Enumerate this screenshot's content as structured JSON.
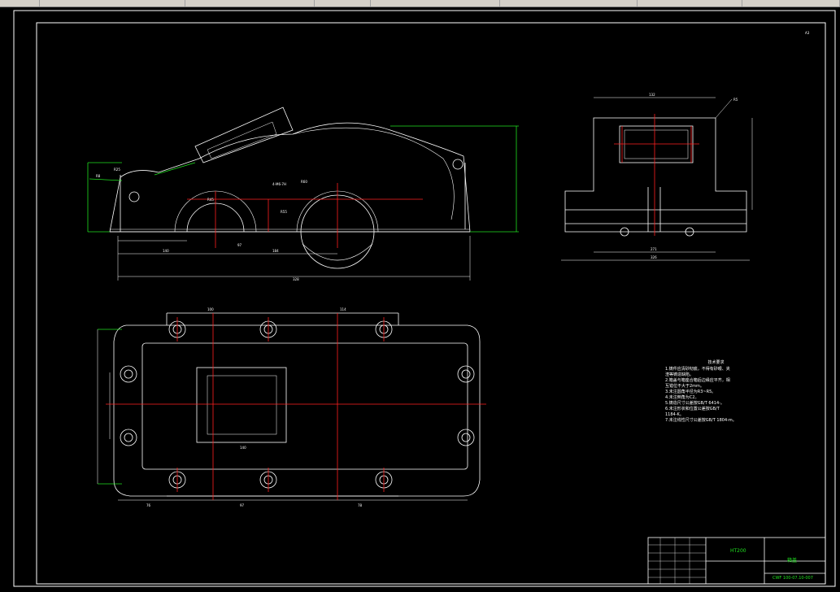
{
  "toolbar": {
    "items": [
      "",
      "",
      "",
      "",
      "",
      "",
      "",
      ""
    ]
  },
  "drawing": {
    "corner_label": "A3",
    "front_view_dims": {
      "d1": "R8",
      "d2": "R25",
      "d3": "R34",
      "d4": "R60",
      "d5": "4-M6-7H",
      "d6": "140",
      "d7": "61",
      "d8": "42",
      "d9": "184",
      "d10": "328",
      "d11": "97",
      "d12": "R55",
      "d13": "R45",
      "d14": "R37",
      "d15": "R40"
    },
    "side_view_dims": {
      "s1": "132",
      "s2": "R5",
      "s3": "271",
      "s4": "326",
      "s5": "6",
      "s6": "10"
    },
    "plan_view_dims": {
      "p1": "100",
      "p2": "114",
      "p3": "140",
      "p4": "100",
      "p5": "97",
      "p6": "78",
      "p7": "76",
      "p8": "78",
      "p9": "140"
    }
  },
  "notes": {
    "title": "技术要求",
    "lines": [
      "1.铸件应清砂彻底，不得有砂眼、夹",
      "渣等铸造缺陷。",
      "2.箱盖与箱座合箱后边缘应平齐，相",
      "互错位不大于2mm。",
      "3.未注圆角半径为R3~R5。",
      "4.未注倒角为C2。",
      "5.铸造尺寸公差按GB/T 6414-。",
      "6.未注形状和位置公差按GB/T",
      "1184-K。",
      "7.未注线性尺寸公差按GB/T 1804-m。"
    ]
  },
  "title_block": {
    "material": "HT200",
    "name": "箱盖",
    "code": "CWF 100-07.10-007"
  },
  "colors": {
    "white": "#ffffff",
    "red": "#ff2020",
    "green": "#20e020",
    "background": "#000000"
  }
}
